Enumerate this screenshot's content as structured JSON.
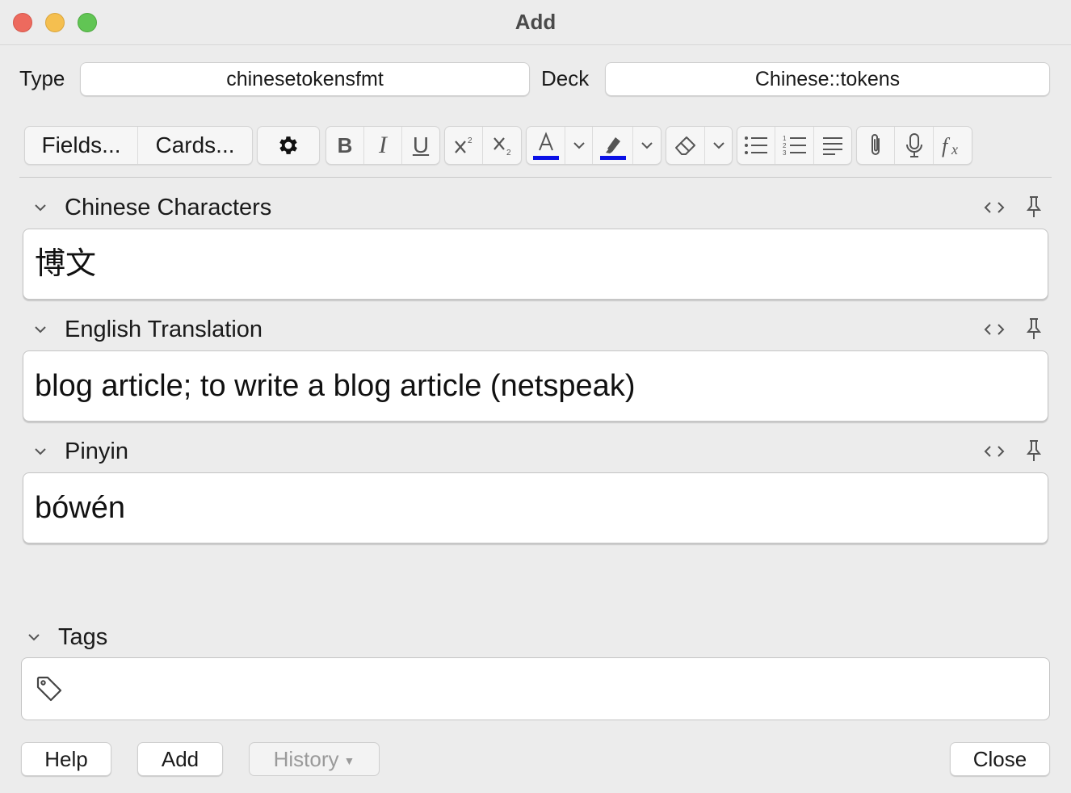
{
  "window": {
    "title": "Add"
  },
  "header": {
    "type_label": "Type",
    "type_value": "chinesetokensfmt",
    "deck_label": "Deck",
    "deck_value": "Chinese::tokens"
  },
  "toolbar": {
    "fields_label": "Fields...",
    "cards_label": "Cards...",
    "icons": [
      "gear-icon",
      "bold-icon",
      "italic-icon",
      "underline-icon",
      "superscript-icon",
      "subscript-icon",
      "text-color-icon",
      "highlight-icon",
      "eraser-icon",
      "bullet-list-icon",
      "numbered-list-icon",
      "align-icon",
      "attachment-icon",
      "microphone-icon",
      "function-icon"
    ],
    "text_color": "#0a10e6",
    "highlight_color": "#0a10e6"
  },
  "fields": [
    {
      "label": "Chinese Characters",
      "value": "博文"
    },
    {
      "label": "English Translation",
      "value": "blog article; to write a blog article (netspeak)"
    },
    {
      "label": "Pinyin",
      "value": "bówén"
    }
  ],
  "tags": {
    "label": "Tags",
    "value": ""
  },
  "buttons": {
    "help": "Help",
    "add": "Add",
    "history": "History",
    "close": "Close"
  }
}
